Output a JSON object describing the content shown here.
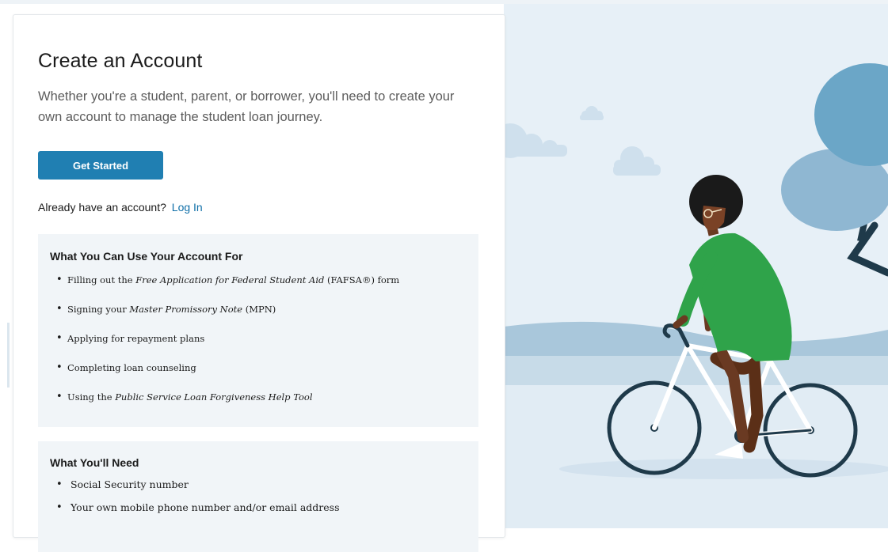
{
  "create_account": {
    "title": "Create an Account",
    "subtitle": "Whether you're a student, parent, or borrower, you'll need to create your own account to manage the student loan journey.",
    "get_started_label": "Get Started",
    "already_have_account": "Already have an account?",
    "login_label": "Log In"
  },
  "uses": {
    "heading": "What You Can Use Your Account For",
    "items": [
      {
        "text_before": "Filling out the ",
        "emphasis": "Free Application for Federal Student Aid",
        "text_after": " (FAFSA®) form"
      },
      {
        "text_before": "Signing your ",
        "emphasis": "Master Promissory Note",
        "text_after": " (MPN)"
      },
      {
        "text": "Applying for repayment plans"
      },
      {
        "text": "Completing loan counseling"
      },
      {
        "text_before": "Using the ",
        "emphasis": "Public Service Loan Forgiveness Help Tool",
        "text_after": ""
      }
    ]
  },
  "needs": {
    "heading": "What You'll Need",
    "items": [
      "Social Security number",
      "Your own mobile phone number and/or email address"
    ]
  },
  "colors": {
    "primary_button": "#207fb2",
    "link": "#0f6fa8",
    "panel_background": "#f1f5f8",
    "sky": "#e7f0f7",
    "dress": "#2fa34a",
    "tree_canopy": "#6ba6c7"
  }
}
